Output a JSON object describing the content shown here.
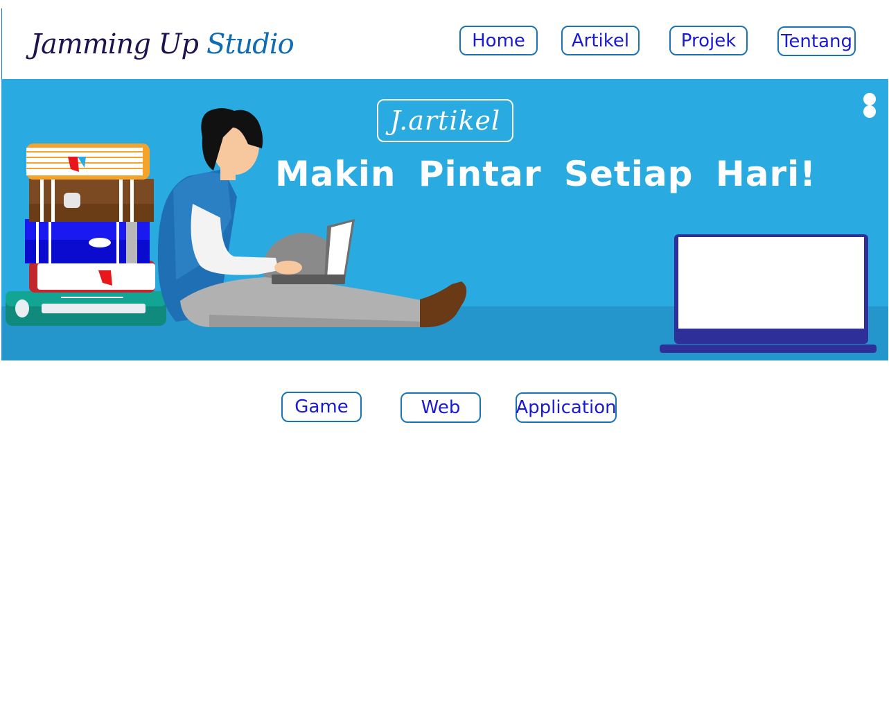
{
  "header": {
    "logo_part1": "Jamming Up",
    "logo_part2": "Studio",
    "nav": [
      "Home",
      "Artikel",
      "Projek",
      "Tentang"
    ]
  },
  "hero": {
    "badge": "J.artikel",
    "headline": "Makin Pintar Setiap Hari!"
  },
  "categories": [
    "Game",
    "Web",
    "Application"
  ],
  "colors": {
    "accent": "#1874b6",
    "button_text": "#1a1ad4",
    "hero_bg": "#29aae1",
    "logo_dark": "#1c1450",
    "logo_blue": "#0f6bb3"
  }
}
